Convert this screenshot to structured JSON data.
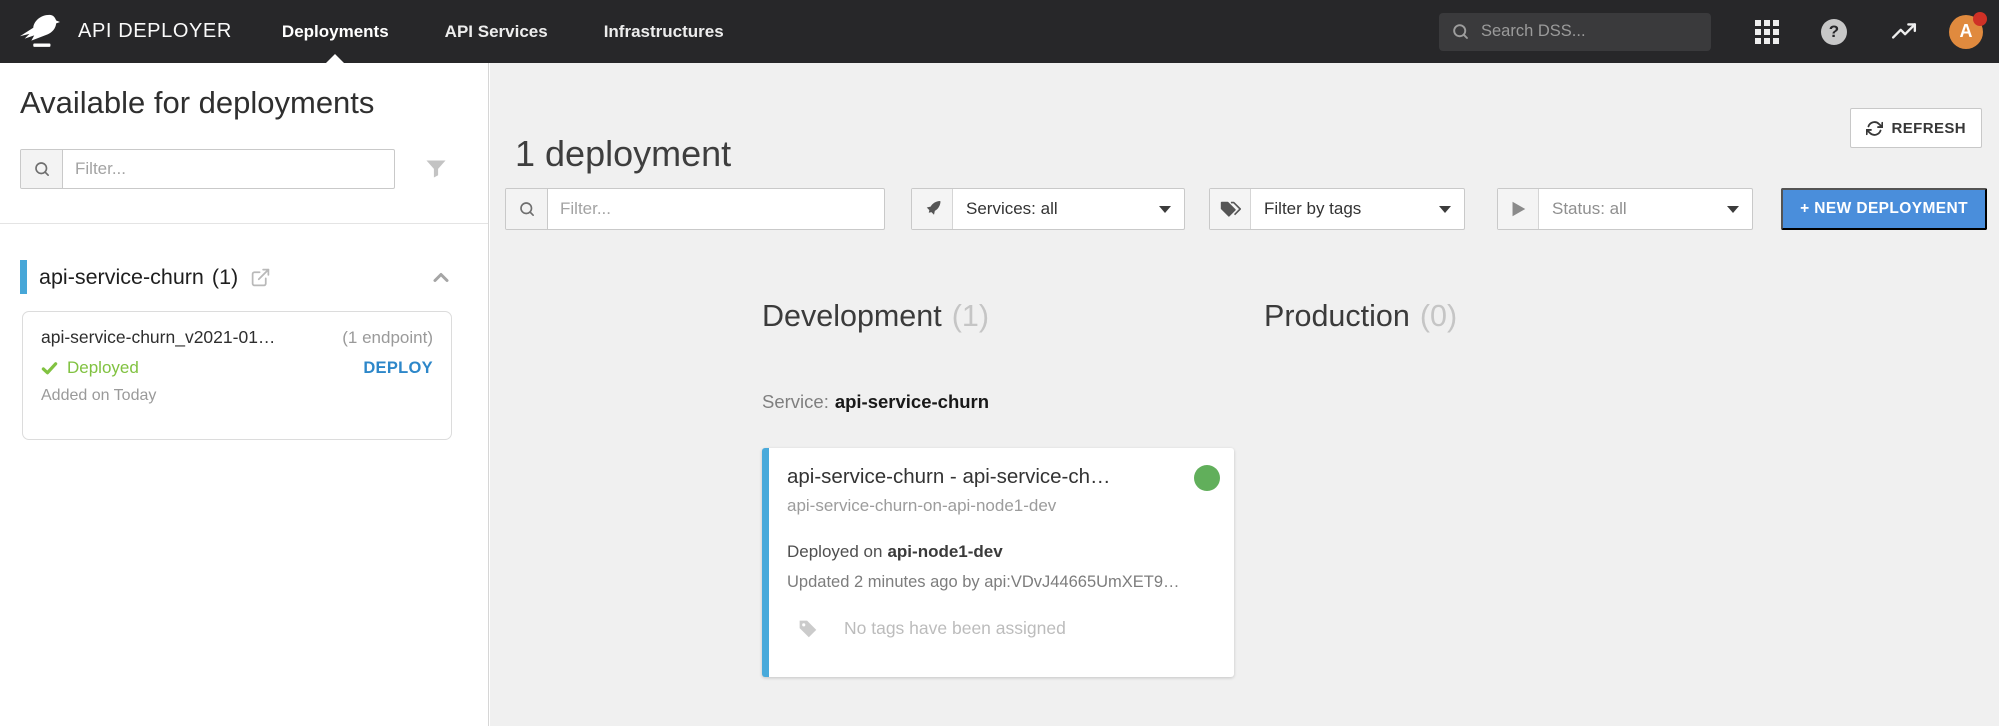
{
  "navbar": {
    "app_title": "API DEPLOYER",
    "tabs": [
      {
        "label": "Deployments"
      },
      {
        "label": "API Services"
      },
      {
        "label": "Infrastructures"
      }
    ],
    "search_placeholder": "Search DSS...",
    "avatar_letter": "A"
  },
  "sidebar": {
    "title": "Available for deployments",
    "filter_placeholder": "Filter...",
    "group": {
      "name": "api-service-churn",
      "count": "(1)"
    },
    "package": {
      "name": "api-service-churn_v2021-01…",
      "endpoints": "(1 endpoint)",
      "status": "Deployed",
      "action": "DEPLOY",
      "added": "Added on Today"
    }
  },
  "main": {
    "title": "1 deployment",
    "refresh_label": "REFRESH",
    "filter_placeholder": "Filter...",
    "services_filter": "Services: all",
    "tags_filter": "Filter by tags",
    "status_filter": "Status: all",
    "new_deployment_label": "+ NEW DEPLOYMENT",
    "columns": [
      {
        "title": "Development",
        "count": "(1)"
      },
      {
        "title": "Production",
        "count": "(0)"
      }
    ],
    "service_label": "Service:",
    "service_name": "api-service-churn",
    "deployment_card": {
      "title": "api-service-churn - api-service-ch…",
      "subtitle": "api-service-churn-on-api-node1-dev",
      "deployed_label": "Deployed on",
      "deployed_target": "api-node1-dev",
      "updated": "Updated 2 minutes ago by api:VDvJ44665UmXET9…",
      "no_tags": "No tags have been assigned"
    }
  },
  "colors": {
    "navbar_bg": "#272729",
    "main_bg": "#f0f0f0",
    "accent_blue": "#2d87c9",
    "card_border_blue": "#49aadb",
    "button_blue": "#4a8edb",
    "deployed_green": "#81c241",
    "status_dot_green": "#61af5b",
    "avatar_orange": "#e08a3e",
    "notification_red": "#cf3126"
  }
}
